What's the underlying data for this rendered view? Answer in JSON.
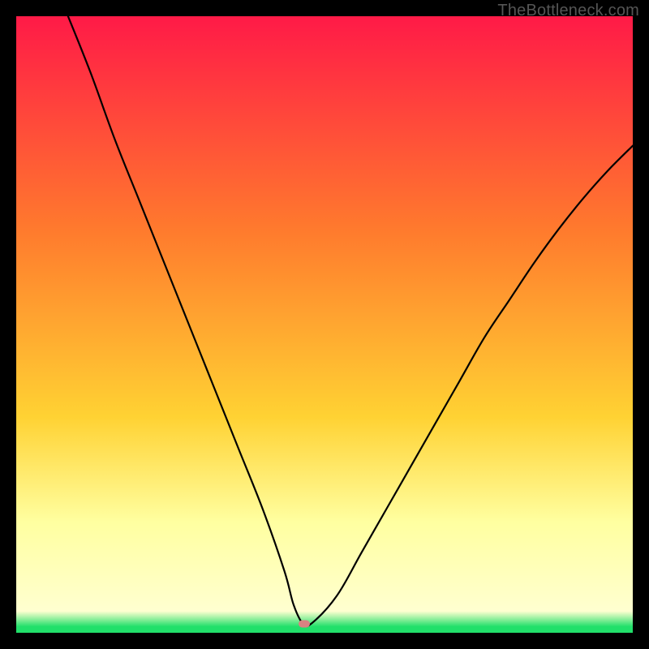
{
  "watermark": "TheBottleneck.com",
  "colors": {
    "frame": "#000000",
    "gradient_top": "#ff1a47",
    "gradient_mid1": "#ff7b2d",
    "gradient_mid2": "#ffd233",
    "gradient_low": "#ffffa0",
    "gradient_bottom": "#21e06a",
    "curve": "#000000",
    "marker": "#d98282"
  },
  "chart_data": {
    "type": "line",
    "title": "",
    "xlabel": "",
    "ylabel": "",
    "xlim": [
      0,
      100
    ],
    "ylim": [
      0,
      100
    ],
    "grid": false,
    "legend": false,
    "series": [
      {
        "name": "bottleneck-curve",
        "x": [
          8,
          12,
          16,
          20,
          24,
          28,
          32,
          36,
          40,
          43.5,
          45,
          46.5,
          48,
          52,
          56,
          60,
          64,
          68,
          72,
          76,
          80,
          84,
          88,
          92,
          96,
          100
        ],
        "y": [
          101,
          91,
          80,
          70,
          60,
          50,
          40,
          30,
          20,
          10,
          4.5,
          1.5,
          1.6,
          6,
          13,
          20,
          27,
          34,
          41,
          48,
          54,
          60,
          65.5,
          70.5,
          75,
          79
        ]
      }
    ],
    "min_marker": {
      "x": 46.7,
      "y": 1.4
    },
    "gradient_stops": [
      {
        "offset": 0.0,
        "color": "#ff1a47"
      },
      {
        "offset": 0.35,
        "color": "#ff7b2d"
      },
      {
        "offset": 0.65,
        "color": "#ffd233"
      },
      {
        "offset": 0.82,
        "color": "#ffffa0"
      },
      {
        "offset": 0.965,
        "color": "#ffffd0"
      },
      {
        "offset": 0.99,
        "color": "#21e06a"
      },
      {
        "offset": 1.0,
        "color": "#21e06a"
      }
    ]
  }
}
